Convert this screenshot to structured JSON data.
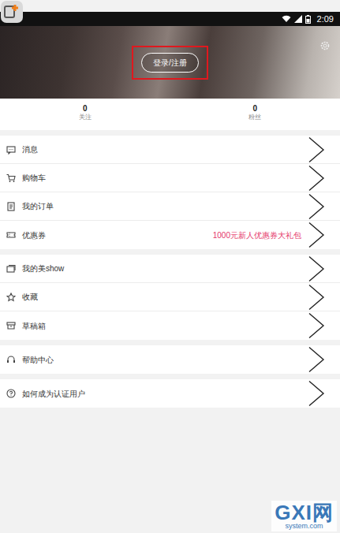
{
  "status_bar": {
    "time": "2:09"
  },
  "header": {
    "login_button": {
      "label": "登录/注册",
      "highlighted": true
    }
  },
  "stats": [
    {
      "value": "0",
      "label": "关注"
    },
    {
      "value": "0",
      "label": "粉丝"
    }
  ],
  "menu_groups": [
    {
      "items": [
        {
          "label": "消息"
        },
        {
          "label": "购物车"
        },
        {
          "label": "我的订单"
        },
        {
          "label": "优惠券",
          "note": "1000元新人优惠券大礼包"
        }
      ]
    },
    {
      "items": [
        {
          "label": "我的美show"
        },
        {
          "label": "收藏"
        },
        {
          "label": "草稿箱"
        }
      ]
    },
    {
      "items": [
        {
          "label": "帮助中心"
        }
      ]
    },
    {
      "items": [
        {
          "label": "如何成为认证用户"
        }
      ]
    }
  ],
  "watermark": {
    "logo": "GXI网",
    "domain": "system.com"
  }
}
